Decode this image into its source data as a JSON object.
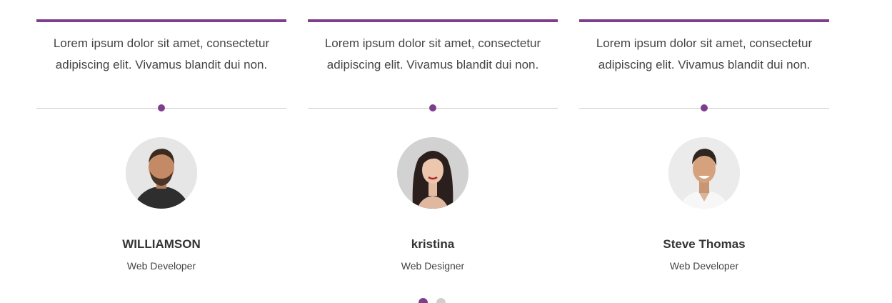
{
  "colors": {
    "accent": "#7d3f8c",
    "divider": "#cfcfcf",
    "inactive_dot": "#cfcfcf"
  },
  "testimonials": [
    {
      "quote": "Lorem ipsum dolor sit amet, consectetur adipiscing elit. Vivamus blandit dui non.",
      "name": "WILLIAMSON",
      "role": "Web Developer",
      "avatar": "man-with-beard-photo"
    },
    {
      "quote": "Lorem ipsum dolor sit amet, consectetur adipiscing elit. Vivamus blandit dui non.",
      "name": "kristina",
      "role": "Web Designer",
      "avatar": "woman-dark-hair-photo"
    },
    {
      "quote": "Lorem ipsum dolor sit amet, consectetur adipiscing elit. Vivamus blandit dui non.",
      "name": "Steve Thomas",
      "role": "Web Developer",
      "avatar": "smiling-man-photo"
    }
  ],
  "pager": {
    "pages": 2,
    "active_page": 1
  }
}
